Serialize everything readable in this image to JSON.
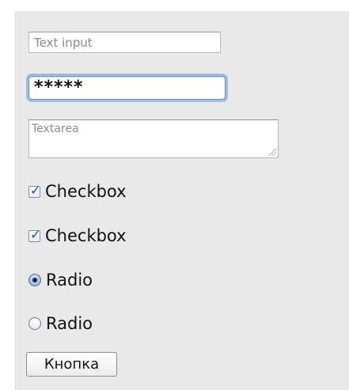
{
  "form": {
    "text_input": {
      "placeholder": "Text input",
      "value": ""
    },
    "password_input": {
      "value": "*****"
    },
    "textarea": {
      "placeholder": "Textarea"
    },
    "checkboxes": [
      {
        "label": "Checkbox",
        "checked": true
      },
      {
        "label": "Checkbox",
        "checked": true
      }
    ],
    "radios": [
      {
        "label": "Radio",
        "selected": true
      },
      {
        "label": "Radio",
        "selected": false
      }
    ],
    "button_label": "Кнопка"
  },
  "colors": {
    "panel_background": "#e9e9e9",
    "focus_ring": "#9fbde2",
    "check_color": "#1f4f8c"
  }
}
